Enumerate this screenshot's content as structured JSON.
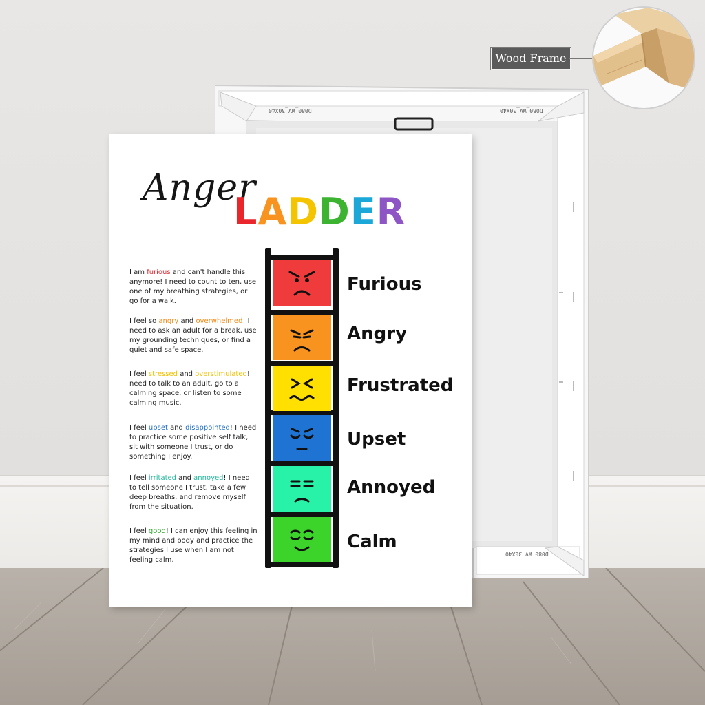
{
  "poster": {
    "title_script": "Anger",
    "title_block": [
      {
        "ch": "L",
        "color": "#e8262c"
      },
      {
        "ch": "A",
        "color": "#f7931e"
      },
      {
        "ch": "D",
        "color": "#f5c400"
      },
      {
        "ch": "D",
        "color": "#3cb432"
      },
      {
        "ch": "E",
        "color": "#1ba7d8"
      },
      {
        "ch": "R",
        "color": "#8e55c4"
      }
    ],
    "paragraphs": [
      {
        "parts": [
          {
            "t": "I am "
          },
          {
            "t": "furious",
            "c": "#d9272e"
          },
          {
            "t": " and can't handle this anymore! I need to count to ten, use one of my breathing strategies, or go for a walk."
          }
        ]
      },
      {
        "parts": [
          {
            "t": "I feel so "
          },
          {
            "t": "angry",
            "c": "#f08c1a"
          },
          {
            "t": " and "
          },
          {
            "t": "overwhelmed",
            "c": "#f08c1a"
          },
          {
            "t": "! I need to ask an adult for a break, use my grounding techniques, or find a quiet and safe space."
          }
        ]
      },
      {
        "parts": [
          {
            "t": "I feel "
          },
          {
            "t": "stressed",
            "c": "#f2c200"
          },
          {
            "t": " and "
          },
          {
            "t": "overstimulated",
            "c": "#f2c200"
          },
          {
            "t": "! I need to talk to an adult, go to a calming space, or listen to some calming music."
          }
        ]
      },
      {
        "parts": [
          {
            "t": "I feel "
          },
          {
            "t": "upset",
            "c": "#1f6fc5"
          },
          {
            "t": " and "
          },
          {
            "t": "disappointed",
            "c": "#1f6fc5"
          },
          {
            "t": "! I need to practice some positive self talk, sit with someone I trust, or do something I enjoy."
          }
        ]
      },
      {
        "parts": [
          {
            "t": "I feel "
          },
          {
            "t": "irritated",
            "c": "#1fb79a"
          },
          {
            "t": " and "
          },
          {
            "t": "annoyed",
            "c": "#1fb79a"
          },
          {
            "t": "! I need to tell someone I trust, take a few deep breaths, and remove myself from the situation."
          }
        ]
      },
      {
        "parts": [
          {
            "t": "I feel "
          },
          {
            "t": "good",
            "c": "#2daa2a"
          },
          {
            "t": "! I can enjoy this feeling in my mind and body and practice the strategies I use when I am not feeling calm."
          }
        ]
      }
    ],
    "steps": [
      {
        "label": "Furious",
        "color": "#ef3b3b",
        "face": "furious"
      },
      {
        "label": "Angry",
        "color": "#f7931e",
        "face": "angry"
      },
      {
        "label": "Frustrated",
        "color": "#ffe000",
        "face": "frustrated"
      },
      {
        "label": "Upset",
        "color": "#1f73d2",
        "face": "upset"
      },
      {
        "label": "Annoyed",
        "color": "#27f2a8",
        "face": "annoyed"
      },
      {
        "label": "Calm",
        "color": "#3cd42a",
        "face": "calm"
      }
    ]
  },
  "back_frame": {
    "stamp_text": "D080_WV_30X40"
  },
  "callout": {
    "label": "Wood Frame"
  }
}
